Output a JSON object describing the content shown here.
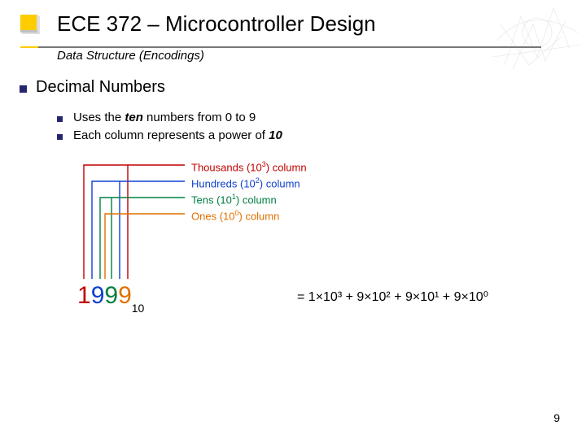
{
  "header": {
    "title": "ECE 372 – Microcontroller Design",
    "subtitle": "Data Structure (Encodings)"
  },
  "section": {
    "heading": "Decimal Numbers",
    "bullets": [
      {
        "pre": "Uses the ",
        "em": "ten",
        "post": " numbers from 0 to 9"
      },
      {
        "pre": "Each column represents a power of ",
        "em": "10",
        "post": ""
      }
    ]
  },
  "diagram": {
    "columns": [
      {
        "name": "Thousands",
        "power": "3",
        "color": "#c00000"
      },
      {
        "name": "Hundreds",
        "power": "2",
        "color": "#1040d0"
      },
      {
        "name": "Tens",
        "power": "1",
        "color": "#008040"
      },
      {
        "name": "Ones",
        "power": "0",
        "color": "#e07000"
      }
    ],
    "number_digits": [
      "1",
      "9",
      "9",
      "9"
    ],
    "number_base": "10",
    "expansion": "= 1×10³ + 9×10² + 9×10¹ + 9×10⁰"
  },
  "page_number": "9"
}
